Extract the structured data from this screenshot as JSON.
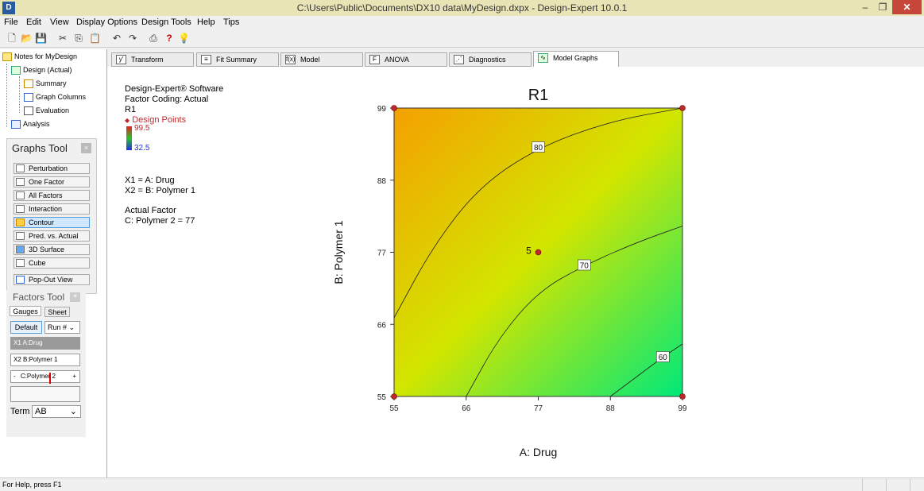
{
  "window": {
    "title": "C:\\Users\\Public\\Documents\\DX10 data\\MyDesign.dxpx - Design-Expert 10.0.1",
    "app_icon": "D",
    "minimize": "–",
    "maximize": "❐",
    "close": "✕"
  },
  "menu": [
    "File",
    "Edit",
    "View",
    "Display Options",
    "Design Tools",
    "Help",
    "Tips"
  ],
  "toolbar_icons": [
    "new-file-icon",
    "open-folder-icon",
    "save-icon",
    "cut-icon",
    "copy-icon",
    "paste-icon",
    "undo-icon",
    "redo-icon",
    "print-icon",
    "help-icon",
    "tip-bulb-icon"
  ],
  "tree": {
    "root": "Notes for MyDesign",
    "design": "Design (Actual)",
    "summary": "Summary",
    "graph_columns": "Graph Columns",
    "evaluation": "Evaluation",
    "analysis": "Analysis"
  },
  "graphs_tool": {
    "title": "Graphs Tool",
    "close": "×",
    "buttons": [
      "Perturbation",
      "One Factor",
      "All Factors",
      "Interaction",
      "Contour",
      "Pred. vs. Actual",
      "3D Surface",
      "Cube"
    ],
    "active": "Contour",
    "popout": "Pop-Out View"
  },
  "factors_tool": {
    "title": "Factors Tool",
    "plus": "+",
    "tab_gauges": "Gauges",
    "tab_sheet": "Sheet",
    "default_btn": "Default",
    "run_select": "Run #",
    "x1": "X1 A:Drug",
    "x2": "X2 B:Polymer 1",
    "c_minus": "-",
    "c_label": "C:Polymer 2",
    "c_plus": "+",
    "term_label": "Term",
    "term_value": "AB"
  },
  "tabs": [
    "Transform",
    "Fit Summary",
    "Model",
    "ANOVA",
    "Diagnostics",
    "Model Graphs"
  ],
  "active_tab": "Model Graphs",
  "info": {
    "software": "Design-Expert® Software",
    "coding": "Factor Coding: Actual",
    "response": "R1",
    "design_points": "Design Points",
    "legend_max": "99.5",
    "legend_min": "32.5",
    "x1": "X1 = A: Drug",
    "x2": "X2 = B: Polymer 1",
    "actual_factor": "Actual Factor",
    "actual_value": "C: Polymer 2 = 77"
  },
  "status": "For Help, press F1",
  "chart_data": {
    "type": "contour",
    "title": "R1",
    "xlabel": "A: Drug",
    "ylabel": "B: Polymer 1",
    "xlim": [
      55,
      99
    ],
    "ylim": [
      55,
      99
    ],
    "x_ticks": [
      "55",
      "66",
      "77",
      "88",
      "99"
    ],
    "y_ticks": [
      "55",
      "66",
      "77",
      "88",
      "99"
    ],
    "contours": [
      {
        "label": "80",
        "points": [
          [
            55,
            67
          ],
          [
            61,
            78
          ],
          [
            68,
            87
          ],
          [
            77,
            93
          ],
          [
            88,
            97
          ],
          [
            99,
            99
          ]
        ]
      },
      {
        "label": "70",
        "points": [
          [
            66,
            55
          ],
          [
            71,
            64
          ],
          [
            77,
            71
          ],
          [
            84,
            75
          ],
          [
            92,
            78.5
          ],
          [
            99,
            81
          ]
        ]
      },
      {
        "label": "60",
        "points": [
          [
            88,
            55
          ],
          [
            92,
            58
          ],
          [
            96,
            61
          ],
          [
            99,
            63
          ]
        ]
      }
    ],
    "design_points": [
      [
        55,
        99
      ],
      [
        99,
        99
      ],
      [
        77,
        77
      ],
      [
        55,
        55
      ],
      [
        99,
        55
      ]
    ],
    "center_label": "5",
    "colors": {
      "high": "#f5a000",
      "mid": "#d2e600",
      "low": "#00e87a"
    }
  }
}
